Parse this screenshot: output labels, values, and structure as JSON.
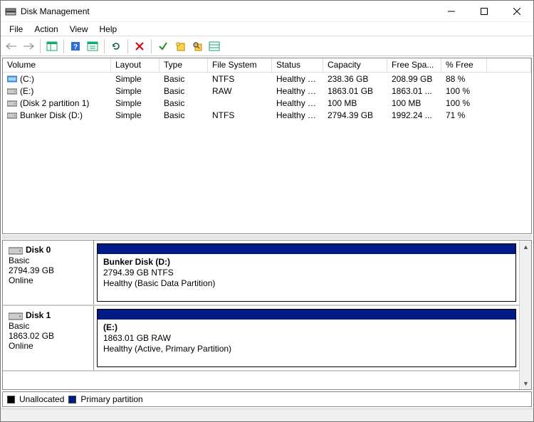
{
  "window": {
    "title": "Disk Management"
  },
  "menu": {
    "file": "File",
    "action": "Action",
    "view": "View",
    "help": "Help"
  },
  "table": {
    "headers": {
      "volume": "Volume",
      "layout": "Layout",
      "type": "Type",
      "filesystem": "File System",
      "status": "Status",
      "capacity": "Capacity",
      "freespace": "Free Spa...",
      "pctfree": "% Free"
    },
    "rows": [
      {
        "icon": "primary",
        "volume": "(C:)",
        "layout": "Simple",
        "type": "Basic",
        "fs": "NTFS",
        "status": "Healthy (B...",
        "capacity": "238.36 GB",
        "free": "208.99 GB",
        "pct": "88 %"
      },
      {
        "icon": "drive",
        "volume": "(E:)",
        "layout": "Simple",
        "type": "Basic",
        "fs": "RAW",
        "status": "Healthy (A...",
        "capacity": "1863.01 GB",
        "free": "1863.01 ...",
        "pct": "100 %"
      },
      {
        "icon": "drive",
        "volume": "(Disk 2 partition 1)",
        "layout": "Simple",
        "type": "Basic",
        "fs": "",
        "status": "Healthy (E...",
        "capacity": "100 MB",
        "free": "100 MB",
        "pct": "100 %"
      },
      {
        "icon": "drive",
        "volume": "Bunker Disk (D:)",
        "layout": "Simple",
        "type": "Basic",
        "fs": "NTFS",
        "status": "Healthy (B...",
        "capacity": "2794.39 GB",
        "free": "1992.24 ...",
        "pct": "71 %"
      }
    ]
  },
  "disks": [
    {
      "name": "Disk 0",
      "dtype": "Basic",
      "size": "2794.39 GB",
      "state": "Online",
      "part": {
        "label": "Bunker Disk  (D:)",
        "sizefs": "2794.39 GB NTFS",
        "health": "Healthy (Basic Data Partition)"
      }
    },
    {
      "name": "Disk 1",
      "dtype": "Basic",
      "size": "1863.02 GB",
      "state": "Online",
      "part": {
        "label": " (E:)",
        "sizefs": "1863.01 GB RAW",
        "health": "Healthy (Active, Primary Partition)"
      }
    }
  ],
  "legend": {
    "unallocated": "Unallocated",
    "primary": "Primary partition"
  }
}
